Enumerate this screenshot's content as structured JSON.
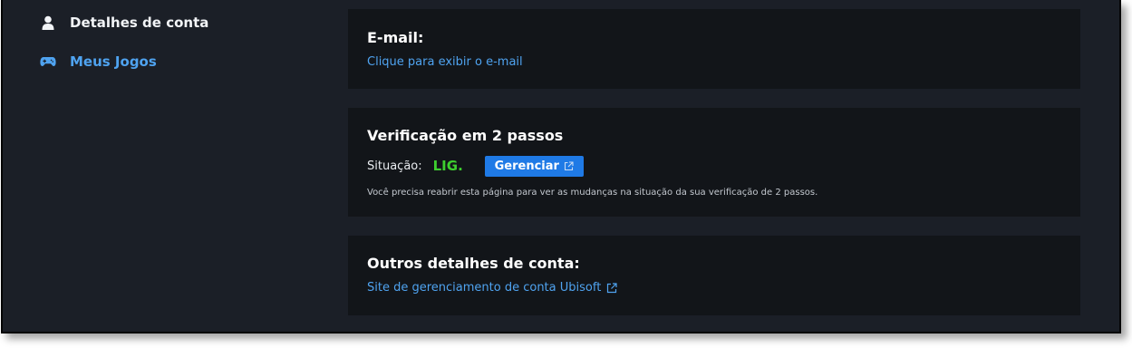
{
  "sidebar": {
    "items": [
      {
        "label": "Detalhes de conta",
        "icon": "user-icon",
        "active": false
      },
      {
        "label": "Meus Jogos",
        "icon": "gamepad-icon",
        "active": true
      }
    ]
  },
  "email_card": {
    "title": "E-mail:",
    "reveal_link": "Clique para exibir o e-mail"
  },
  "two_factor_card": {
    "title": "Verificação em 2 passos",
    "status_label": "Situação:",
    "status_value": "LIG.",
    "manage_button": "Gerenciar",
    "note": "Você precisa reabrir esta página para ver as mudanças na situação da sua verificação de 2 passos."
  },
  "other_card": {
    "title": "Outros detalhes de conta:",
    "account_link": "Site de gerenciamento de conta Ubisoft"
  },
  "colors": {
    "background": "#1b1f27",
    "card": "#121519",
    "link": "#4fa3f0",
    "status_on": "#3ecf2f",
    "button": "#1f7ae6"
  }
}
